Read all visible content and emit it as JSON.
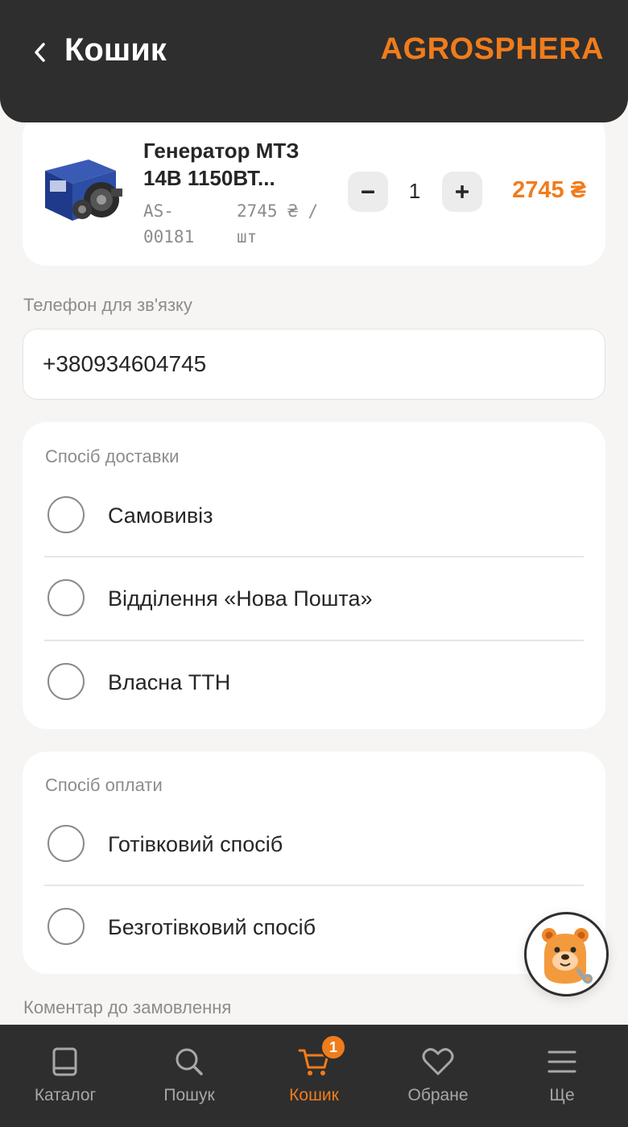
{
  "header": {
    "title": "Кошик",
    "brand": "AGROSPHERA"
  },
  "cart_item": {
    "name": "Генератор МТЗ 14В 1150ВТ...",
    "name_line1": "Генератор МТЗ",
    "name_line2": "14В 1150ВТ...",
    "sku_line1": "AS-",
    "sku_line2": "00181",
    "unit_price_line1": "2745 ₴ /",
    "unit_price_line2": "шт",
    "quantity": "1",
    "minus_label": "–",
    "plus_label": "+",
    "total": "2745 ₴"
  },
  "phone": {
    "label": "Телефон для зв'язку",
    "value": "+380934604745"
  },
  "delivery": {
    "title": "Спосіб доставки",
    "options": [
      {
        "label": "Самовивіз",
        "selected": false
      },
      {
        "label": "Відділення «Нова Пошта»",
        "selected": false
      },
      {
        "label": "Власна ТТН",
        "selected": false
      }
    ]
  },
  "payment": {
    "title": "Спосіб оплати",
    "options": [
      {
        "label": "Готівковий спосіб",
        "selected": false
      },
      {
        "label": "Безготівковий спосіб",
        "selected": false
      }
    ]
  },
  "comment": {
    "label": "Коментар до замовлення"
  },
  "bottom_nav": {
    "items": [
      {
        "label": "Каталог",
        "icon": "book-icon",
        "active": false
      },
      {
        "label": "Пошук",
        "icon": "search-icon",
        "active": false
      },
      {
        "label": "Кошик",
        "icon": "cart-icon",
        "active": true
      },
      {
        "label": "Обране",
        "icon": "heart-icon",
        "active": false
      },
      {
        "label": "Ще",
        "icon": "menu-icon",
        "active": false
      }
    ],
    "cart_badge": "1"
  },
  "colors": {
    "accent": "#f07c1c",
    "header_bg": "#2e2e2e",
    "page_bg": "#f6f5f3"
  }
}
